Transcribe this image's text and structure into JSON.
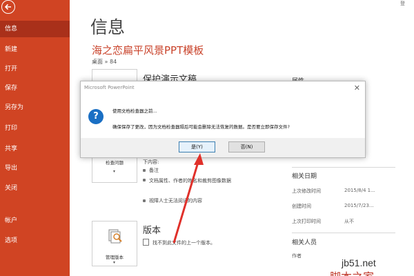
{
  "nav": {
    "items": [
      {
        "label": "信息",
        "active": true
      },
      {
        "label": "新建"
      },
      {
        "label": "打开"
      },
      {
        "label": "保存"
      },
      {
        "label": "另存为"
      },
      {
        "label": "打印"
      },
      {
        "label": "共享"
      },
      {
        "label": "导出"
      },
      {
        "label": "关闭"
      },
      {
        "label": "帐户"
      },
      {
        "label": "选项"
      }
    ]
  },
  "main": {
    "title": "信息",
    "doc_title": "海之恋扁平风景PPT模板",
    "doc_path": "桌面 » 84",
    "protect": {
      "heading": "保护演示文稿"
    },
    "inspect": {
      "button_label": "检查问题",
      "list_heading": "下内容:",
      "items": [
        "备注",
        "文档属性、作者的姓名和裁剪图像数据",
        "视障人士无法阅读的内容"
      ]
    },
    "versions": {
      "heading": "版本",
      "button_label": "管理版本",
      "note": "找不到此文件的上一个版本。"
    }
  },
  "right_panel": {
    "props_heading": "属性",
    "dates_heading": "相关日期",
    "dates": [
      {
        "label": "上次修改时间",
        "value": "2015/8/4 1..."
      },
      {
        "label": "创建时间",
        "value": "2015/7/23..."
      },
      {
        "label": "上次打印时间",
        "value": "从不"
      }
    ],
    "people_heading": "相关人员",
    "author_label": "作者"
  },
  "dialog": {
    "title": "Microsoft PowerPoint",
    "message1": "使用文档检查器之前...",
    "message2": "确保保存了更改，因为文档检查器隔后可能会删除无法恢复的数据。是否要立即保存文件?",
    "yes_label": "是(Y)",
    "no_label": "否(N)"
  },
  "watermark": {
    "site": "jb51.net",
    "text": "脚本之家"
  },
  "top_right": "登"
}
